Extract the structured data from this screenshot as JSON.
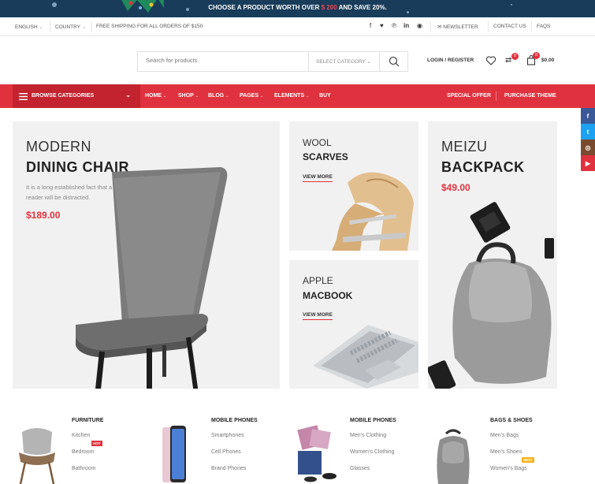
{
  "promo": {
    "text_before": "CHOOSE A PRODUCT WORTH OVER ",
    "price": "$ 200",
    "text_after": " AND SAVE 20%."
  },
  "topbar": {
    "language": "ENGLISH",
    "country": "COUNTRY",
    "shipping": "FREE SHIPPING FOR ALL ORDERS OF $150",
    "newsletter": "NEWSLETTER",
    "contact": "CONTACT US",
    "faqs": "FAQS"
  },
  "header": {
    "search_placeholder": "Search for products",
    "select_category": "SELECT CATEGORY",
    "login": "LOGIN / REGISTER",
    "compare_count": "0",
    "cart_count": "0",
    "cart_total": "$0.00"
  },
  "nav": {
    "browse": "BROWSE CATEGORIES",
    "items": [
      "HOME",
      "SHOP",
      "BLOG",
      "PAGES",
      "ELEMENTS",
      "BUY"
    ],
    "special_offer": "SPECIAL OFFER",
    "purchase": "PURCHASE THEME"
  },
  "banners": {
    "chair": {
      "line1": "MODERN",
      "line2": "DINING CHAIR",
      "desc1": "It is a long established fact that a",
      "desc2": "reader will be distracted.",
      "price": "$189.00"
    },
    "wool": {
      "line1": "WOOL",
      "line2": "SCARVES",
      "link": "VIEW MORE"
    },
    "apple": {
      "line1": "APPLE",
      "line2": "MACBOOK",
      "link": "VIEW MORE"
    },
    "meizu": {
      "line1": "MEIZU",
      "line2": "BACKPACK",
      "price": "$49.00"
    }
  },
  "categories": [
    {
      "title": "FURNITURE",
      "items": [
        "Kitchen",
        "Bedroom",
        "Bathroom"
      ]
    },
    {
      "title": "MOBILE PHONES",
      "items": [
        "Smartphones",
        "Cell Phones",
        "Brand Phones"
      ]
    },
    {
      "title": "MOBILE PHONES",
      "items": [
        "Men's Clothing",
        "Women's Clothing",
        "Glasses"
      ]
    },
    {
      "title": "BAGS & SHOES",
      "items": [
        "Men's Bags",
        "Men's Shoes",
        "Women's Bags"
      ]
    }
  ],
  "badges": {
    "hot": "HOT",
    "best": "BEST"
  },
  "colors": {
    "accent": "#e0323e",
    "promo_bg": "#183c5a",
    "browse_bg": "#c2232f"
  },
  "social_sidebar": [
    "facebook-icon",
    "twitter-icon",
    "instagram-icon",
    "youtube-icon"
  ]
}
